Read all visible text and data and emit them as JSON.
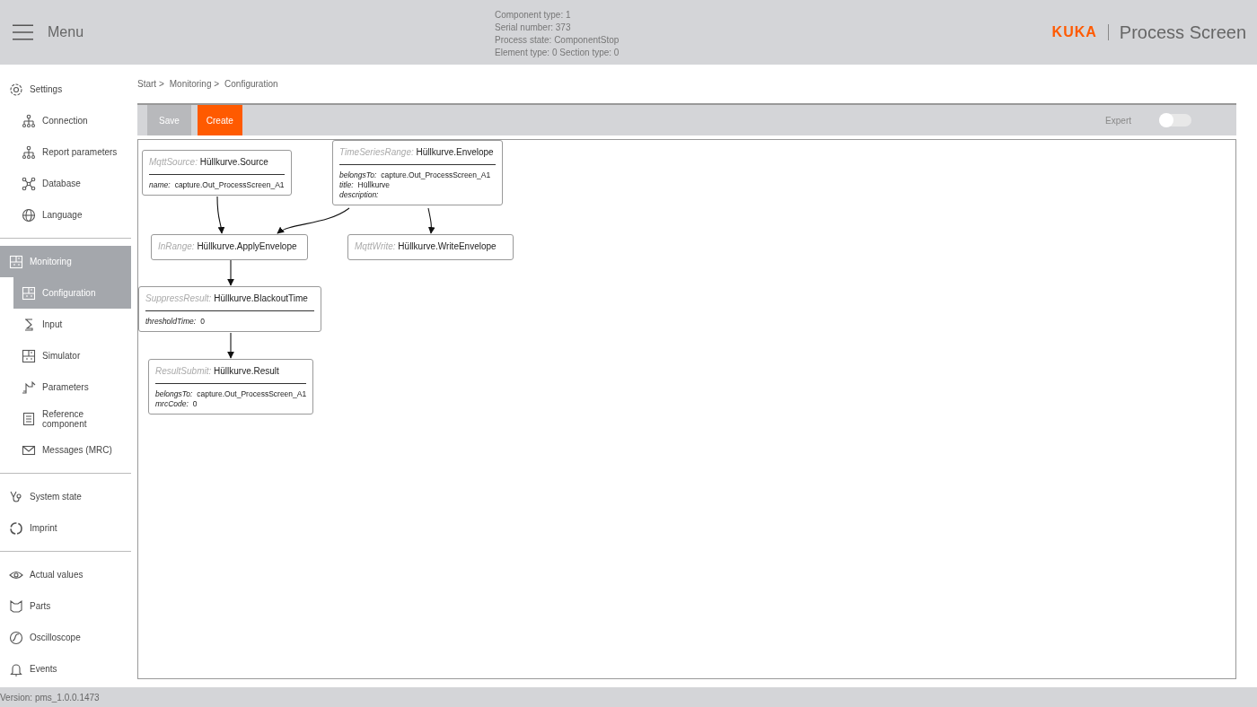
{
  "header": {
    "menu_label": "Menu",
    "info_lines": [
      "Component type: 1",
      "Serial number: 373",
      "Process state: ComponentStop",
      "Element type: 0 Section type: 0"
    ],
    "brand": "KUKA",
    "app_title": "Process Screen"
  },
  "sidebar": {
    "sections": [
      {
        "items": [
          {
            "label": "Settings",
            "kind": "gear",
            "selected": false,
            "children": [
              {
                "label": "Connection",
                "kind": "tree",
                "selected": false
              },
              {
                "label": "Report parameters",
                "kind": "tree",
                "selected": false
              },
              {
                "label": "Database",
                "kind": "nodes",
                "selected": false
              },
              {
                "label": "Language",
                "kind": "globe",
                "selected": false
              }
            ]
          }
        ]
      },
      {
        "items": [
          {
            "label": "Monitoring",
            "kind": "panel",
            "selected": true,
            "children": [
              {
                "label": "Configuration",
                "kind": "panel",
                "selected": true
              },
              {
                "label": "Input",
                "kind": "robot",
                "selected": false
              },
              {
                "label": "Simulator",
                "kind": "panel",
                "selected": false
              },
              {
                "label": "Parameters",
                "kind": "signal",
                "selected": false
              },
              {
                "label": "Reference component",
                "kind": "list",
                "selected": false
              },
              {
                "label": "Messages (MRC)",
                "kind": "mail",
                "selected": false
              }
            ]
          }
        ]
      },
      {
        "items": [
          {
            "label": "System state",
            "kind": "stetho",
            "selected": false
          },
          {
            "label": "Imprint",
            "kind": "ring",
            "selected": false
          }
        ]
      },
      {
        "items": [
          {
            "label": "Actual values",
            "kind": "eye",
            "selected": false
          },
          {
            "label": "Parts",
            "kind": "parts",
            "selected": false
          },
          {
            "label": "Oscilloscope",
            "kind": "scope",
            "selected": false
          },
          {
            "label": "Events",
            "kind": "bell",
            "selected": false
          }
        ]
      }
    ]
  },
  "breadcrumb": [
    "Start >",
    "Monitoring >",
    "Configuration"
  ],
  "toolbar": {
    "buttons": [
      {
        "label": "Save",
        "disabled": true
      },
      {
        "label": "Create",
        "disabled": false
      }
    ],
    "expert": {
      "label": "Expert",
      "on": false
    }
  },
  "diagram": {
    "nodes": [
      {
        "type": "MqttSource:",
        "name": "Hüllkurve.Source",
        "properties": [
          {
            "key": "name:",
            "value": "capture.Out_ProcessScreen_A1"
          }
        ]
      },
      {
        "type": "TimeSeriesRange:",
        "name": "Hüllkurve.Envelope",
        "properties": [
          {
            "key": "belongsTo:",
            "value": "capture.Out_ProcessScreen_A1"
          },
          {
            "key": "title:",
            "value": "Hüllkurve"
          },
          {
            "key": "description:"
          }
        ]
      },
      {
        "type": "InRange:",
        "name": "Hüllkurve.ApplyEnvelope"
      },
      {
        "type": "MqttWrite:",
        "name": "Hüllkurve.WriteEnvelope"
      },
      {
        "type": "SuppressResult:",
        "name": "Hüllkurve.BlackoutTime",
        "properties": [
          {
            "key": "thresholdTime:",
            "value": "0"
          }
        ]
      },
      {
        "type": "ResultSubmit:",
        "name": "Hüllkurve.Result",
        "properties": [
          {
            "key": "belongsTo:",
            "value": "capture.Out_ProcessScreen_A1"
          },
          {
            "key": "mrcCode:",
            "value": "0"
          }
        ]
      }
    ]
  },
  "footer": {
    "version": "Version: pms_1.0.0.1473"
  }
}
